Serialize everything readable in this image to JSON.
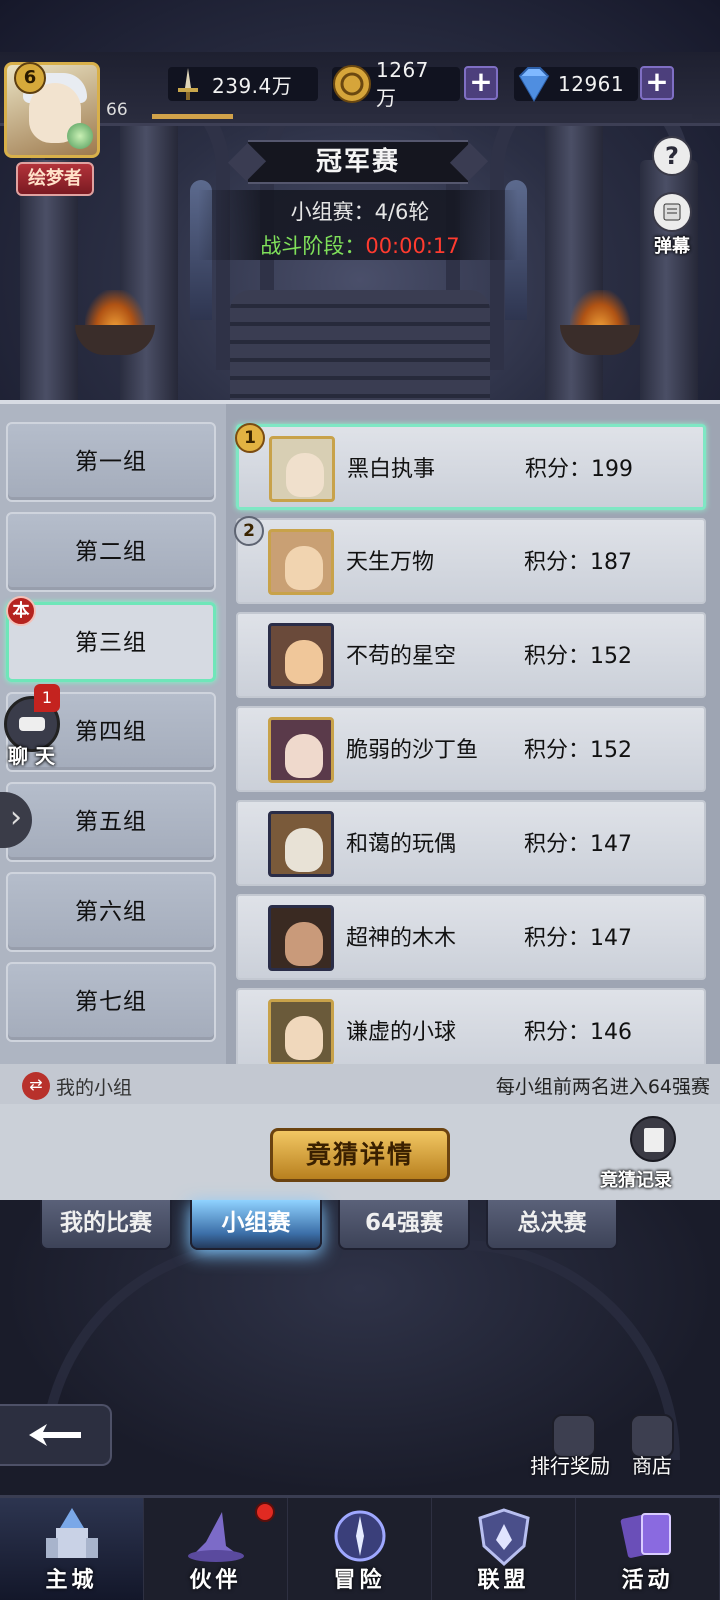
{
  "player": {
    "level": "6",
    "exp_level": "66",
    "exp_progress": 0.15,
    "title": "绘梦者"
  },
  "resources": {
    "power": "239.4万",
    "gold": "1267万",
    "diamond": "12961"
  },
  "header": {
    "title": "冠军赛",
    "round_text": "小组赛：4/6轮",
    "phase_label": "战斗阶段：",
    "phase_time": "00:00:17",
    "help_glyph": "?",
    "danmu_label": "弹幕"
  },
  "groups": [
    {
      "label": "第一组"
    },
    {
      "label": "第二组"
    },
    {
      "label": "第三组"
    },
    {
      "label": "第四组"
    },
    {
      "label": "第五组"
    },
    {
      "label": "第六组"
    },
    {
      "label": "第七组"
    }
  ],
  "mine_badge": "本",
  "players": [
    {
      "rank": "1",
      "name": "黑白执事",
      "score": "积分：199"
    },
    {
      "rank": "2",
      "name": "天生万物",
      "score": "积分：187"
    },
    {
      "rank": "",
      "name": "不苟的星空",
      "score": "积分：152"
    },
    {
      "rank": "",
      "name": "脆弱的沙丁鱼",
      "score": "积分：152"
    },
    {
      "rank": "",
      "name": "和蔼的玩偶",
      "score": "积分：147"
    },
    {
      "rank": "",
      "name": "超神的木木",
      "score": "积分：147"
    },
    {
      "rank": "",
      "name": "谦虚的小球",
      "score": "积分：146"
    }
  ],
  "chat": {
    "label": "聊 天",
    "count": "1"
  },
  "footer": {
    "my_group": "我的小组",
    "rule": "每小组前两名进入64强赛"
  },
  "bet": {
    "button": "竟猜详情",
    "record": "竟猜记录"
  },
  "subtabs": [
    {
      "label": "我的比赛"
    },
    {
      "label": "小组赛"
    },
    {
      "label": "64强赛"
    },
    {
      "label": "总决赛"
    }
  ],
  "shortcuts": {
    "rank_reward": "排行奖励",
    "shop": "商店"
  },
  "nav": [
    {
      "label": "主城"
    },
    {
      "label": "伙伴"
    },
    {
      "label": "冒险"
    },
    {
      "label": "联盟"
    },
    {
      "label": "活动"
    }
  ],
  "colors": {
    "accent_green": "#7fe05a",
    "timer_red": "#ff3b2f",
    "highlight_teal": "#6fe6b9",
    "gold_button": "#f2c763"
  }
}
